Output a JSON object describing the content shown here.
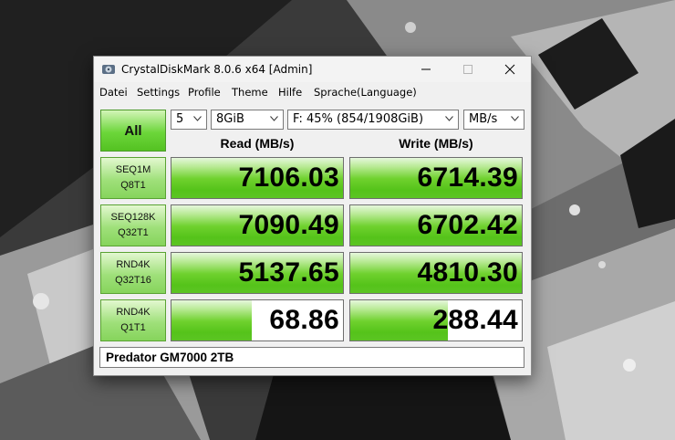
{
  "window": {
    "title": "CrystalDiskMark 8.0.6 x64 [Admin]"
  },
  "menu": [
    "Datei",
    "Settings",
    "Profile",
    "Theme",
    "Hilfe",
    "Sprache(Language)"
  ],
  "controls": {
    "all_label": "All",
    "count": "5",
    "size": "8GiB",
    "drive": "F: 45% (854/1908GiB)",
    "unit": "MB/s"
  },
  "headers": {
    "read": "Read (MB/s)",
    "write": "Write (MB/s)"
  },
  "tests": [
    {
      "line1": "SEQ1M",
      "line2": "Q8T1",
      "read": "7106.03",
      "write": "6714.39",
      "read_fill": 1.0,
      "write_fill": 1.0
    },
    {
      "line1": "SEQ128K",
      "line2": "Q32T1",
      "read": "7090.49",
      "write": "6702.42",
      "read_fill": 1.0,
      "write_fill": 1.0
    },
    {
      "line1": "RND4K",
      "line2": "Q32T16",
      "read": "5137.65",
      "write": "4810.30",
      "read_fill": 1.0,
      "write_fill": 1.0
    },
    {
      "line1": "RND4K",
      "line2": "Q1T1",
      "read": "68.86",
      "write": "288.44",
      "read_fill": 0.47,
      "write_fill": 0.57
    }
  ],
  "comment": "Predator GM7000 2TB",
  "colors": {
    "bar_green": "#55c31a",
    "button_green": "#6cd63a"
  }
}
